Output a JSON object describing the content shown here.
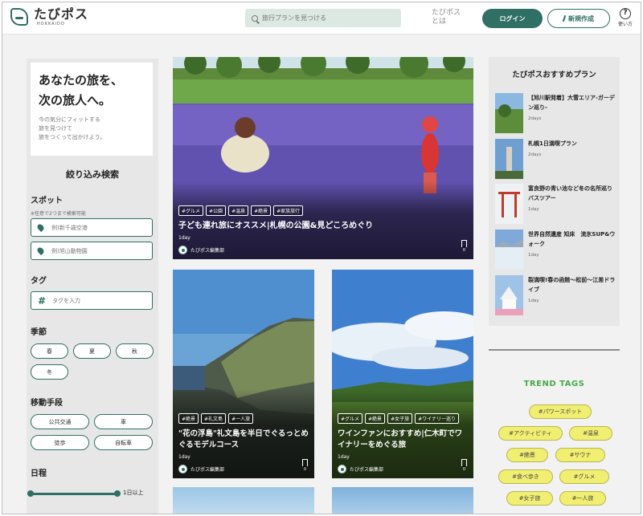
{
  "header": {
    "logo_title": "たびポス",
    "logo_sub": "HOKKAIDO",
    "search_placeholder": "旅行プランを見つける",
    "about": "たびポス\nとは",
    "login": "ログイン",
    "new_post": "新規作成",
    "help_mark": "?",
    "help_label": "使い方"
  },
  "hero": {
    "title": "あなたの旅を、\n次の旅人へ。",
    "sub": "今の気分にフィットする\n旅を見つけて\n旅をつくって出かけよう。"
  },
  "filters": {
    "title": "絞り込み検索",
    "spot": {
      "label": "スポット",
      "note": "※任意で2つまで検索可能",
      "placeholder1": "例)新千歳空港",
      "placeholder2": "例)旭山動物園"
    },
    "tag": {
      "label": "タグ",
      "placeholder": "タグを入力"
    },
    "season": {
      "label": "季節",
      "options": [
        "春",
        "夏",
        "秋",
        "冬"
      ]
    },
    "transport": {
      "label": "移動手段",
      "options": [
        "公共交通",
        "車",
        "徒歩",
        "自転車"
      ]
    },
    "days": {
      "label": "日程",
      "value_label": "1日以上"
    }
  },
  "cards": [
    {
      "tags": [
        "#グルメ",
        "#公園",
        "#温泉",
        "#絶景",
        "#家族旅行"
      ],
      "title": "子ども連れ旅にオススメ|札幌の公園&見どころめぐり",
      "days": "1day",
      "author": "たびポス編集部",
      "bookmarks": "0"
    },
    {
      "tags": [
        "#絶景",
        "#礼文島",
        "#一人旅"
      ],
      "title": "\"花の浮島\"礼文島を半日でぐるっとめぐるモデルコース",
      "days": "1day",
      "author": "たびポス編集部",
      "bookmarks": "0"
    },
    {
      "tags": [
        "#グルメ",
        "#絶景",
        "#女子旅",
        "#ワイナリー巡り"
      ],
      "title": "ワインファンにおすすめ|仁木町でワイナリーをめぐる旅",
      "days": "1day",
      "author": "たびポス編集部",
      "bookmarks": "0"
    }
  ],
  "recommend": {
    "title": "たびポスおすすめプラン",
    "items": [
      {
        "name": "【旭川駅発着】大雪エリア-ガーデン巡り-",
        "days": "2days"
      },
      {
        "name": "札幌1日満喫プラン",
        "days": "2days"
      },
      {
        "name": "富良野の青い池など冬の名所巡りバスツアー",
        "days": "1day"
      },
      {
        "name": "世界自然遺産 知床　流氷SUP&ウォーク",
        "days": "1day"
      },
      {
        "name": "裂満喫!春の函館～松前～江差ドライブ",
        "days": "1day"
      }
    ]
  },
  "trend": {
    "title": "TREND TAGS",
    "tags": [
      "#パワースポット",
      "#アクティビティ",
      "#温泉",
      "#絶景",
      "#サウナ",
      "#食べ歩き",
      "#グルメ",
      "#女子旅",
      "#一人旅"
    ]
  },
  "colors": {
    "brand": "#2f6f64",
    "trend_tag": "#f1ef72",
    "trend_title": "#4aa84a"
  }
}
